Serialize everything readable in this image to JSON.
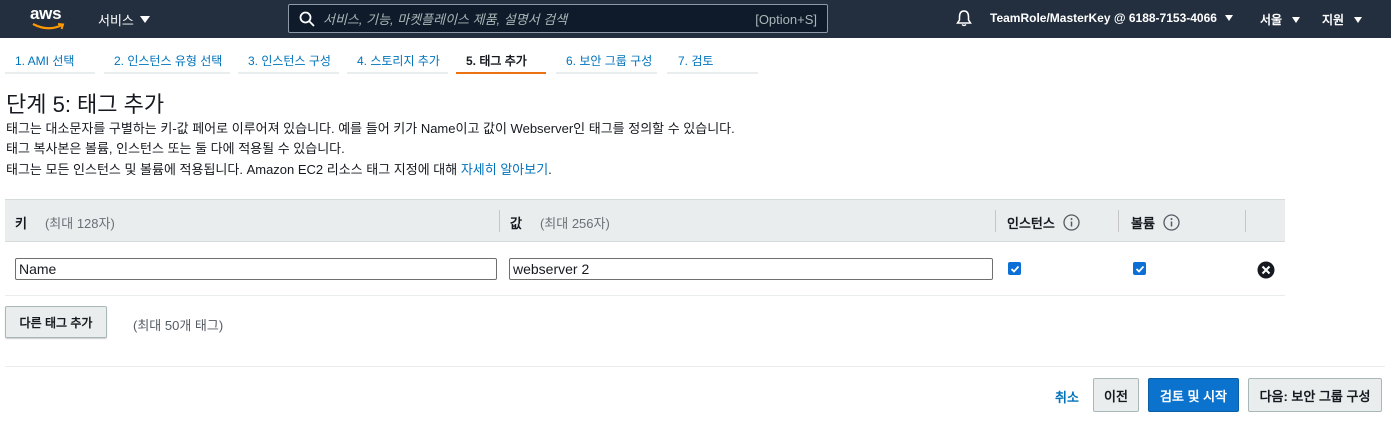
{
  "topnav": {
    "logo_text": "aws",
    "services_label": "서비스",
    "search_placeholder": "서비스, 기능, 마켓플레이스 제품, 설명서 검색",
    "search_shortcut": "[Option+S]",
    "account_label": "TeamRole/MasterKey @ 6188-7153-4066",
    "region_label": "서울",
    "support_label": "지원"
  },
  "tabs": [
    {
      "label": "1. AMI 선택"
    },
    {
      "label": "2. 인스턴스 유형 선택"
    },
    {
      "label": "3. 인스턴스 구성"
    },
    {
      "label": "4. 스토리지 추가"
    },
    {
      "label": "5. 태그 추가",
      "active": true
    },
    {
      "label": "6. 보안 그룹 구성"
    },
    {
      "label": "7. 검토"
    }
  ],
  "page": {
    "title": "단계 5: 태그 추가",
    "desc1": "태그는 대소문자를 구별하는 키-값 페어로 이루어져 있습니다. 예를 들어 키가 Name이고 값이 Webserver인 태그를 정의할 수 있습니다.",
    "desc2": "태그 복사본은 볼륨, 인스턴스 또는 둘 다에 적용될 수 있습니다.",
    "desc3_prefix": "태그는 모든 인스턴스 및 볼륨에 적용됩니다. Amazon EC2 리소스 태그 지정에 대해 ",
    "desc3_link": "자세히 알아보기",
    "desc3_suffix": "."
  },
  "table": {
    "col_key": "키",
    "col_key_hint": "(최대 128자)",
    "col_value": "값",
    "col_value_hint": "(최대 256자)",
    "col_instances": "인스턴스",
    "col_volumes": "볼륨",
    "rows": [
      {
        "key": "Name",
        "value": "webserver 2",
        "instances": true,
        "volumes": true
      }
    ]
  },
  "actions": {
    "add_tag": "다른 태그 추가",
    "add_tag_hint": "(최대 50개 태그)",
    "cancel": "취소",
    "previous": "이전",
    "review_launch": "검토 및 시작",
    "next": "다음: 보안 그룹 구성"
  },
  "colors": {
    "nav_bg": "#232f3e",
    "link": "#0073bb",
    "active_tab": "#ec7211",
    "primary": "#0b73ce"
  }
}
